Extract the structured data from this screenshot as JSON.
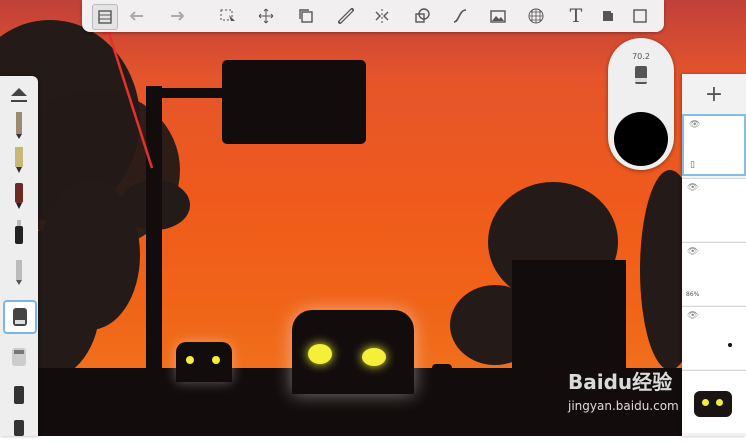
{
  "app": "SketchBook drawing canvas",
  "toolbar": {
    "items": [
      {
        "name": "layer-editor-icon"
      },
      {
        "name": "undo-icon"
      },
      {
        "name": "redo-icon"
      },
      {
        "name": "select-icon"
      },
      {
        "name": "transform-icon"
      },
      {
        "name": "copy-icon"
      },
      {
        "name": "ruler-icon"
      },
      {
        "name": "symmetry-icon"
      },
      {
        "name": "shapes-icon"
      },
      {
        "name": "curve-icon"
      },
      {
        "name": "image-icon"
      },
      {
        "name": "perspective-icon"
      },
      {
        "name": "text-icon",
        "label": "T"
      },
      {
        "name": "fill-icon"
      },
      {
        "name": "fullscreen-icon"
      }
    ]
  },
  "brush_puck": {
    "size_value": "70.2",
    "color": "#000000"
  },
  "layers": {
    "add_label": "+",
    "items": [
      {
        "opacity": ""
      },
      {
        "opacity": ""
      },
      {
        "opacity": "86%"
      },
      {
        "opacity": ""
      },
      {
        "opacity": ""
      }
    ]
  },
  "watermark": {
    "brand": "Baidu经验",
    "url": "jingyan.baidu.com"
  },
  "colors": {
    "sky_top": "#c0403a",
    "sky_mid": "#ef5a1c",
    "silhouette": "#120d0c",
    "headlight": "#f4f03a",
    "annotation_arrow": "#e8302a",
    "selection_blue": "#7cb6e4"
  }
}
